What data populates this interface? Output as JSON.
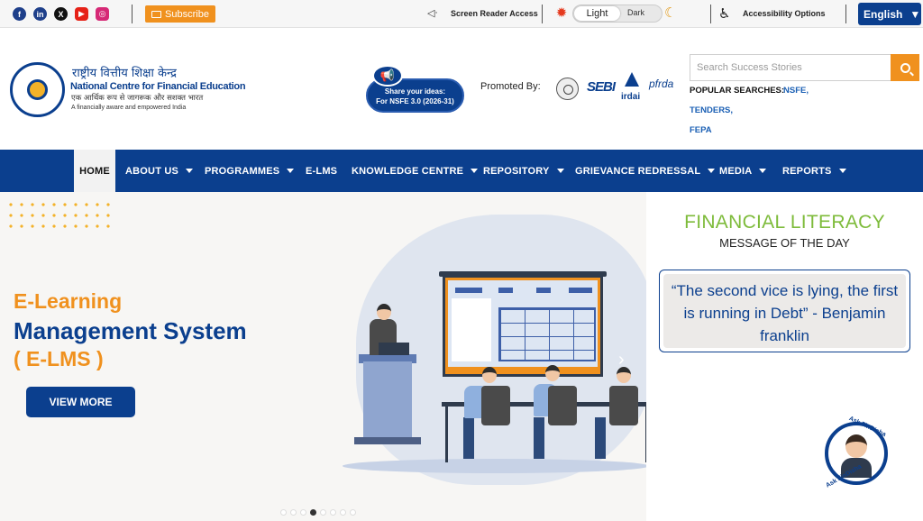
{
  "topbar": {
    "social": [
      {
        "name": "facebook",
        "glyph": "f"
      },
      {
        "name": "linkedin",
        "glyph": "in"
      },
      {
        "name": "x",
        "glyph": "X"
      },
      {
        "name": "youtube",
        "glyph": "▶"
      },
      {
        "name": "instagram",
        "glyph": "◎"
      }
    ],
    "subscribe_label": "Subscribe",
    "screen_reader_label": "Screen Reader Access",
    "theme_light": "Light",
    "theme_dark": "Dark",
    "accessibility_label": "Accessibility Options",
    "language": "English",
    "language_arrow": "▼"
  },
  "header": {
    "org_hindi": "राष्ट्रीय वित्तीय शिक्षा केन्द्र",
    "org_name": "National Centre for Financial Education",
    "org_hindi_tagline": "एक आर्थिक रूप से जागरूक और सशक्त भारत",
    "org_tagline": "A financially aware and empowered India",
    "share_line1": "Share your ideas:",
    "share_line2": "For NSFE 3.0 (2026-31)",
    "promoted_by": "Promoted By:",
    "promoter_sebi": "SEBI",
    "promoter_irdai": "irdai",
    "promoter_pfrda": "pfrda",
    "search_placeholder": "Search Success Stories",
    "popular_label": "POPULAR SEARCHES:",
    "popular_links": [
      "NSFE,",
      "TENDERS,",
      "FEPA"
    ]
  },
  "nav": {
    "items": [
      {
        "label": "HOME",
        "dropdown": false,
        "active": true
      },
      {
        "label": "ABOUT US",
        "dropdown": true
      },
      {
        "label": "PROGRAMMES",
        "dropdown": true
      },
      {
        "label": "E-LMS",
        "dropdown": false
      },
      {
        "label": "KNOWLEDGE CENTRE",
        "dropdown": true
      },
      {
        "label": "REPOSITORY",
        "dropdown": true
      },
      {
        "label": "GRIEVANCE REDRESSAL",
        "dropdown": true
      },
      {
        "label": "MEDIA",
        "dropdown": true
      },
      {
        "label": "REPORTS",
        "dropdown": true
      }
    ]
  },
  "hero": {
    "title_line1": "E-Learning",
    "title_line2": "Management System",
    "title_line3": "( E-LMS )",
    "cta_label": "VIEW MORE",
    "next_arrow": "›",
    "slide_count": 8,
    "active_slide": 4
  },
  "literacy": {
    "title": "FINANCIAL LITERACY",
    "subtitle": "MESSAGE OF THE DAY",
    "quote": "“The second vice is lying, the first is running in Debt” - Benjamin franklin"
  },
  "chatbot": {
    "label_top": "Ask FinDisha",
    "label_bottom": "Ask FinDisha"
  },
  "colors": {
    "brand_blue": "#0b3f8e",
    "accent_orange": "#f0911e",
    "literacy_green": "#7dbb3a"
  }
}
